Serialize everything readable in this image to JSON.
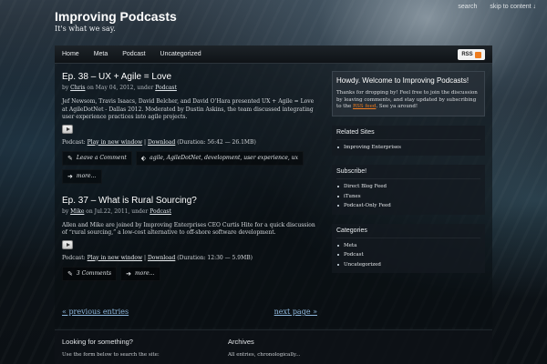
{
  "site": {
    "title": "Improving Podcasts",
    "tagline": "It's what we say."
  },
  "top_links": {
    "search": "search",
    "skip": "skip to content ↓"
  },
  "nav": {
    "items": [
      "Home",
      "Meta",
      "Podcast",
      "Uncategorized"
    ],
    "rss_label": "RSS"
  },
  "posts": [
    {
      "title": "Ep. 38 – UX + Agile = Love",
      "meta_author": "Chris",
      "meta_date": " on May 04, 2012, under ",
      "meta_category": "Podcast",
      "meta_by": "by ",
      "body": "Jef Newsom, Travis Isaacs, David Belcher, and David O’Hara presented UX + Agile = Love at AgileDotNet - Dallas 2012. Moderated by Dustin Askins, the team discussed integrating user experience practices into agile projects.",
      "podcast_prefix": "Podcast: ",
      "play_new_window": "Play in new window",
      "sep": " | ",
      "download": "Download",
      "duration": " (Duration: 56:42 — 26.1MB)",
      "comments": "Leave a Comment",
      "tags": "agile, AgileDotNet, development, user experience, ux",
      "more": "more..."
    },
    {
      "title": "Ep. 37 – What is Rural Sourcing?",
      "meta_author": "Mike",
      "meta_date": " on Jul.22, 2011, under ",
      "meta_category": "Podcast",
      "meta_by": "by ",
      "body": "Allen and Mike are joined by Improving Enterprises CEO Curtis Hite for a quick discussion of “rural sourcing,” a low-cost alternative to off-shore software development.",
      "podcast_prefix": "Podcast: ",
      "play_new_window": "Play in new window",
      "sep": " | ",
      "download": "Download",
      "duration": " (Duration: 12:30 — 5.9MB)",
      "comments": "3 Comments",
      "more": "more..."
    }
  ],
  "sidebar": {
    "welcome": {
      "title": "Howdy. Welcome to Improving Podcasts!",
      "body_pre": "Thanks for dropping by! Feel free to join the discussion by leaving comments, and stay updated by subscribing to the ",
      "rss_link": "RSS feed",
      "body_post": ". See ya around!"
    },
    "related": {
      "title": "Related Sites",
      "items": [
        "Improving Enterprises"
      ]
    },
    "subscribe": {
      "title": "Subscribe!",
      "items": [
        "Direct Blog Feed",
        "iTunes",
        "Podcast-Only Feed"
      ]
    },
    "categories": {
      "title": "Categories",
      "items": [
        "Meta",
        "Podcast",
        "Uncategorized"
      ]
    }
  },
  "pagination": {
    "previous": "« previous entries",
    "next": "next page »"
  },
  "footer": {
    "search_title": "Looking for something?",
    "search_desc": "Use the form below to search the site:",
    "archives_title": "Archives",
    "archives_desc": "All entries, chronologically..."
  },
  "colors": {
    "rss_orange": "#f07d20",
    "link_blue": "#8fb8dd"
  }
}
